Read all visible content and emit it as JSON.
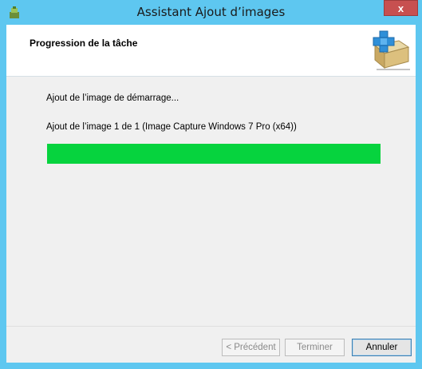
{
  "window": {
    "title": "Assistant Ajout d’images",
    "close_glyph": "x"
  },
  "header": {
    "title": "Progression de la tâche",
    "icon": "add-image-box-icon"
  },
  "status": {
    "line1": "Ajout de l’image de démarrage...",
    "line2": "Ajout de l’image 1 de 1 (Image Capture Windows 7 Pro (x64))"
  },
  "progress": {
    "percent": 100,
    "fill_color": "#06d33e"
  },
  "buttons": {
    "previous": "< Précédent",
    "finish": "Terminer",
    "cancel": "Annuler"
  },
  "colors": {
    "titlebar": "#5ec7f0",
    "close": "#c75050"
  }
}
